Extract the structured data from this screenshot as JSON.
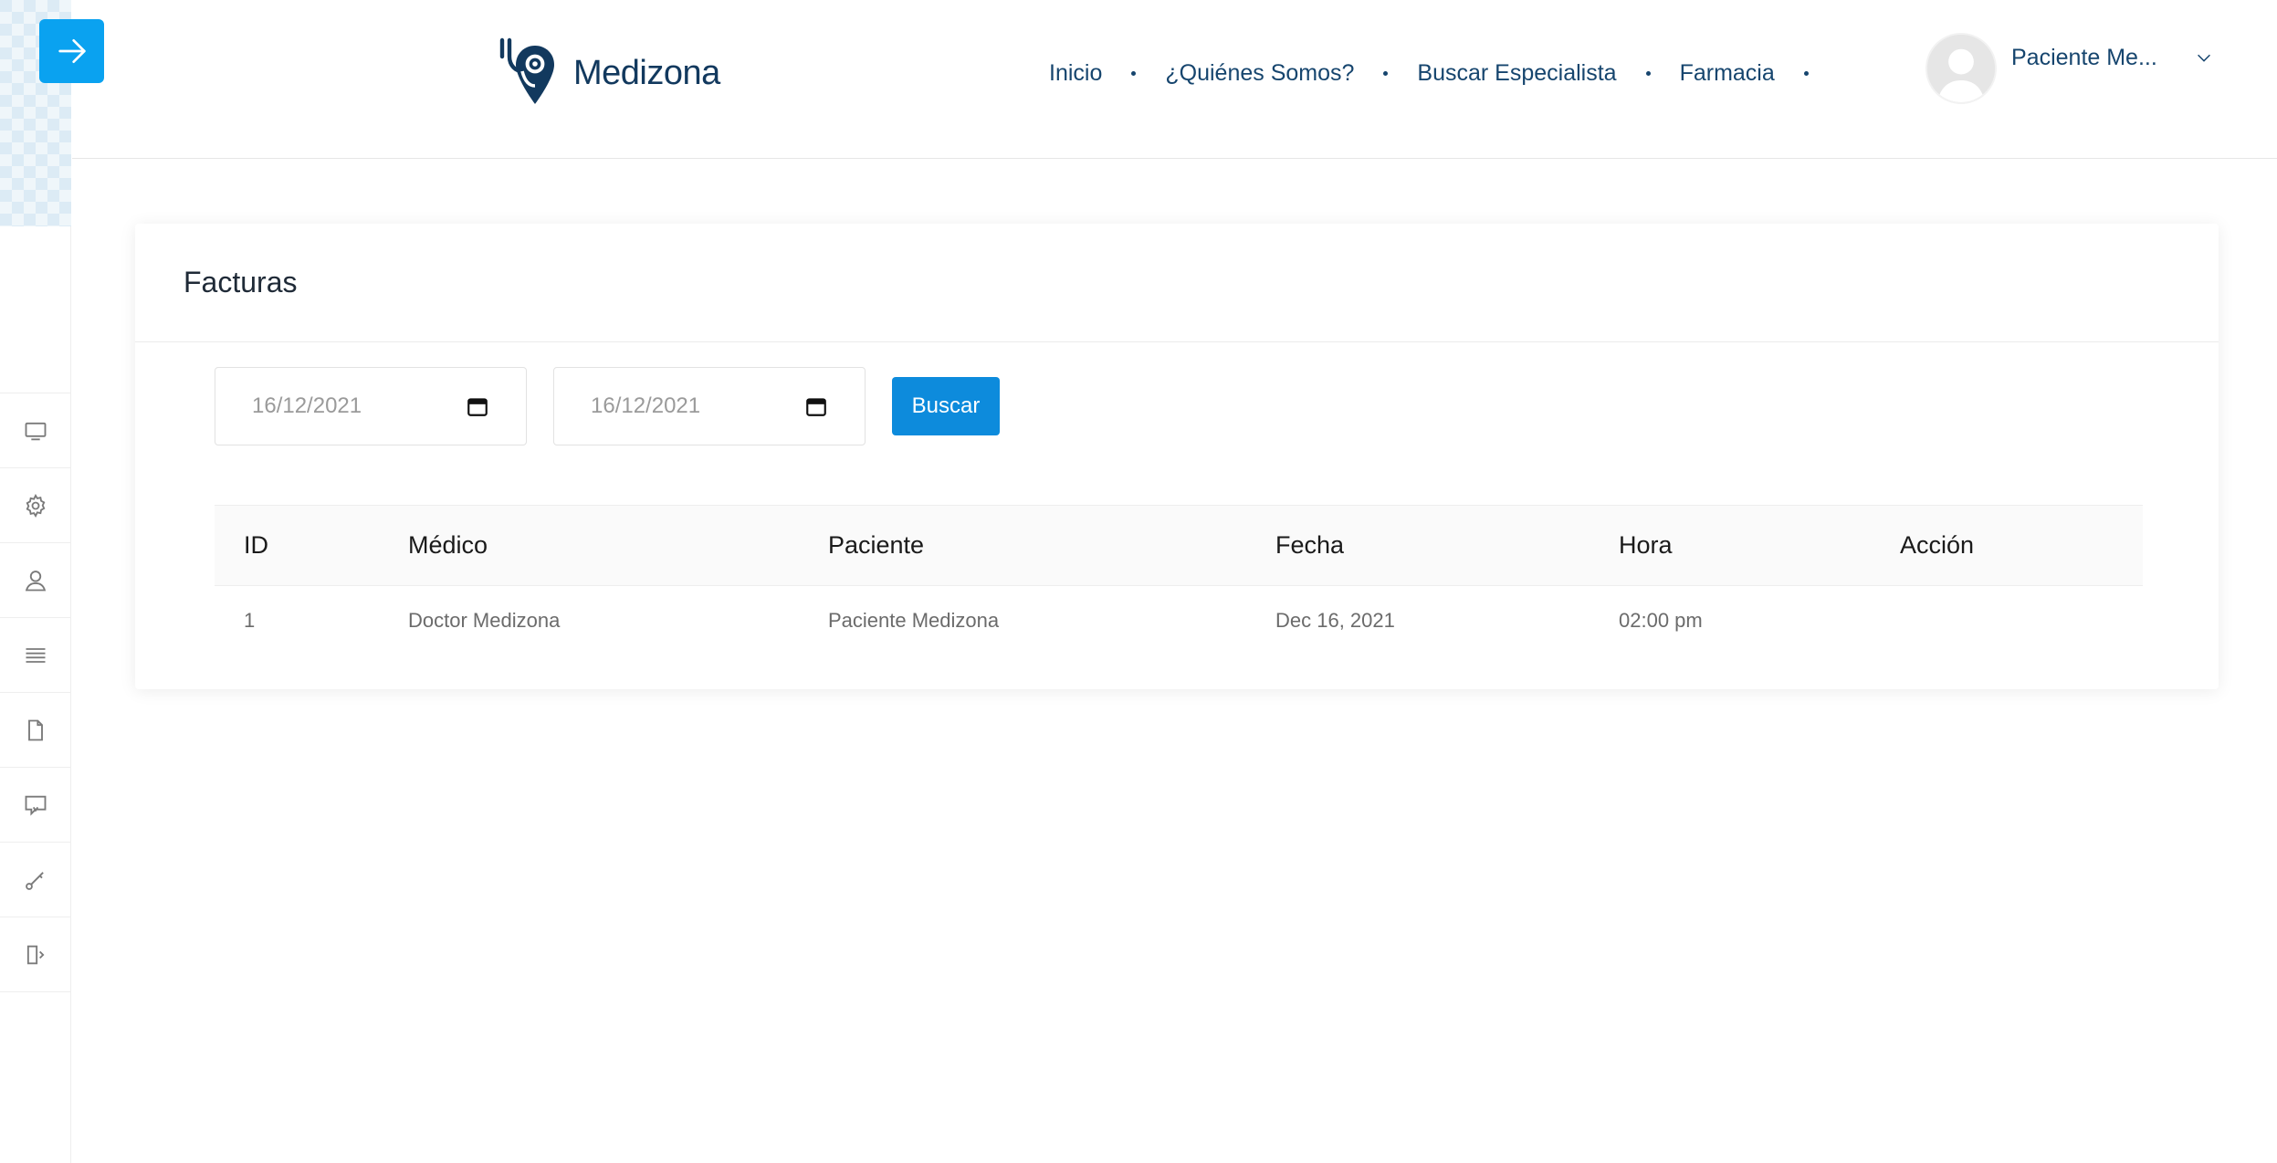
{
  "brand": {
    "name": "Medizona",
    "primary_color": "#0aa2f0",
    "nav_color": "#16456e"
  },
  "header": {
    "nav": [
      {
        "label": "Inicio"
      },
      {
        "label": "¿Quiénes Somos?"
      },
      {
        "label": "Buscar Especialista"
      },
      {
        "label": "Farmacia"
      }
    ],
    "user": {
      "name": "Paciente Me..."
    }
  },
  "sidebar": {
    "items": [
      {
        "icon": "monitor-icon"
      },
      {
        "icon": "gear-icon"
      },
      {
        "icon": "user-icon"
      },
      {
        "icon": "list-icon"
      },
      {
        "icon": "file-icon"
      },
      {
        "icon": "chat-icon"
      },
      {
        "icon": "key-icon"
      },
      {
        "icon": "logout-icon"
      }
    ]
  },
  "card": {
    "title": "Facturas",
    "filters": {
      "date_from": "16/12/2021",
      "date_to": "16/12/2021",
      "search_label": "Buscar"
    },
    "table": {
      "headers": [
        "ID",
        "Médico",
        "Paciente",
        "Fecha",
        "Hora",
        "Acción"
      ],
      "rows": [
        [
          "1",
          "Doctor Medizona",
          "Paciente Medizona",
          "Dec 16, 2021",
          "02:00 pm",
          ""
        ]
      ]
    }
  }
}
